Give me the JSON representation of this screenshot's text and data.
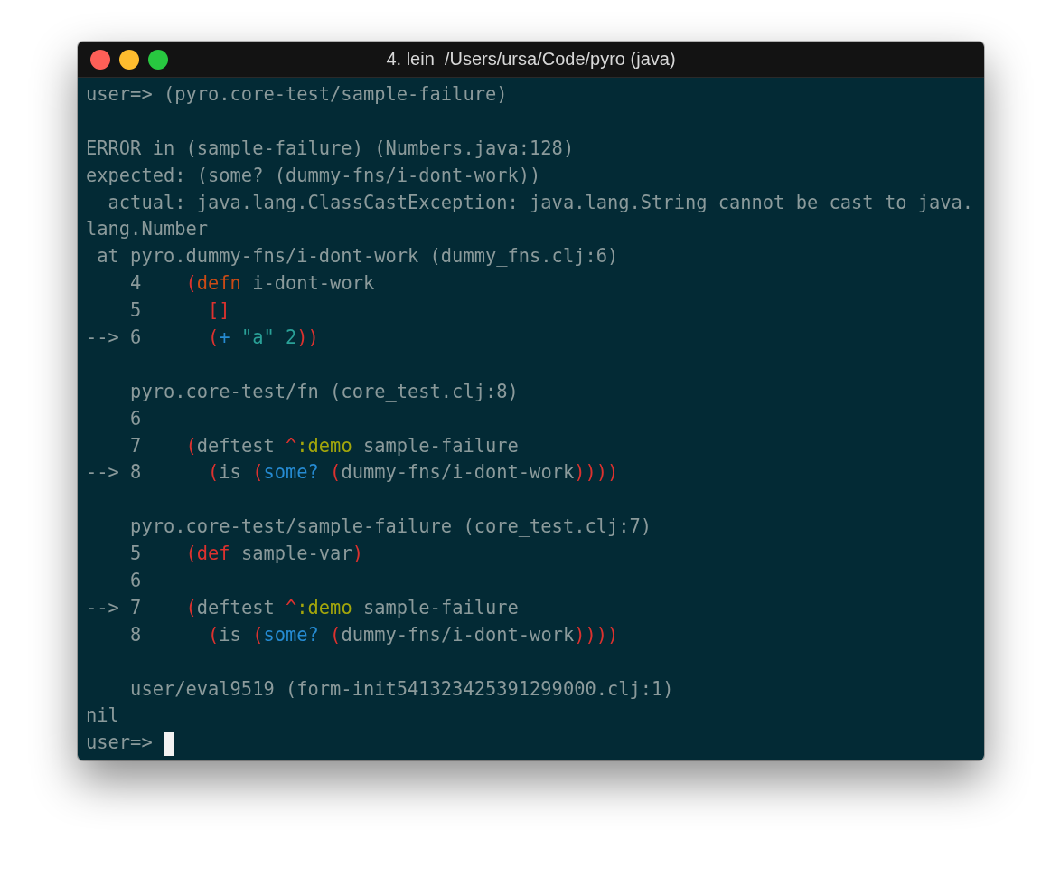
{
  "window": {
    "title": "4. lein  /Users/ursa/Code/pyro (java)"
  },
  "terminal": {
    "lines": [
      {
        "kind": "text",
        "segments": [
          {
            "text": "user=> (pyro.core-test/sample-failure)",
            "kind": "plain"
          }
        ]
      },
      {
        "kind": "blank"
      },
      {
        "kind": "text",
        "segments": [
          {
            "text": "ERROR in (sample-failure) (Numbers.java:128)",
            "kind": "plain"
          }
        ]
      },
      {
        "kind": "text",
        "segments": [
          {
            "text": "expected: (some? (dummy-fns/i-dont-work))",
            "kind": "plain"
          }
        ]
      },
      {
        "kind": "text",
        "segments": [
          {
            "text": "  actual: java.lang.ClassCastException: java.lang.String cannot be cast to java.",
            "kind": "plain"
          }
        ]
      },
      {
        "kind": "text",
        "segments": [
          {
            "text": "lang.Number",
            "kind": "plain"
          }
        ]
      },
      {
        "kind": "text",
        "segments": [
          {
            "text": " at pyro.dummy-fns/i-dont-work (dummy_fns.clj:6)",
            "kind": "plain"
          }
        ]
      },
      {
        "kind": "text",
        "segments": [
          {
            "text": "    4    ",
            "kind": "plain"
          },
          {
            "text": "(",
            "kind": "paren"
          },
          {
            "text": "defn",
            "kind": "macro"
          },
          {
            "text": " i-dont-work",
            "kind": "plain"
          }
        ]
      },
      {
        "kind": "text",
        "segments": [
          {
            "text": "    5      ",
            "kind": "plain"
          },
          {
            "text": "[]",
            "kind": "paren"
          }
        ]
      },
      {
        "kind": "text",
        "segments": [
          {
            "text": "--> 6      ",
            "kind": "plain"
          },
          {
            "text": "(",
            "kind": "paren"
          },
          {
            "text": "+",
            "kind": "function"
          },
          {
            "text": " \"a\"",
            "kind": "literal"
          },
          {
            "text": " 2",
            "kind": "literal"
          },
          {
            "text": "))",
            "kind": "paren"
          }
        ]
      },
      {
        "kind": "blank"
      },
      {
        "kind": "text",
        "segments": [
          {
            "text": "    pyro.core-test/fn (core_test.clj:8)",
            "kind": "plain"
          }
        ]
      },
      {
        "kind": "text",
        "segments": [
          {
            "text": "    6",
            "kind": "plain"
          }
        ]
      },
      {
        "kind": "text",
        "segments": [
          {
            "text": "    7    ",
            "kind": "plain"
          },
          {
            "text": "(",
            "kind": "paren"
          },
          {
            "text": "deftest ",
            "kind": "plain"
          },
          {
            "text": "^",
            "kind": "paren"
          },
          {
            "text": ":demo",
            "kind": "keyword"
          },
          {
            "text": " sample-failure",
            "kind": "plain"
          }
        ]
      },
      {
        "kind": "text",
        "segments": [
          {
            "text": "--> 8      ",
            "kind": "plain"
          },
          {
            "text": "(",
            "kind": "paren"
          },
          {
            "text": "is ",
            "kind": "plain"
          },
          {
            "text": "(",
            "kind": "paren"
          },
          {
            "text": "some?",
            "kind": "function"
          },
          {
            "text": " (",
            "kind": "paren"
          },
          {
            "text": "dummy-fns/i-dont-work",
            "kind": "plain"
          },
          {
            "text": "))))",
            "kind": "paren"
          }
        ]
      },
      {
        "kind": "blank"
      },
      {
        "kind": "text",
        "segments": [
          {
            "text": "    pyro.core-test/sample-failure (core_test.clj:7)",
            "kind": "plain"
          }
        ]
      },
      {
        "kind": "text",
        "segments": [
          {
            "text": "    5    ",
            "kind": "plain"
          },
          {
            "text": "(",
            "kind": "paren"
          },
          {
            "text": "def",
            "kind": "special"
          },
          {
            "text": " sample-var",
            "kind": "plain"
          },
          {
            "text": ")",
            "kind": "paren"
          }
        ]
      },
      {
        "kind": "text",
        "segments": [
          {
            "text": "    6",
            "kind": "plain"
          }
        ]
      },
      {
        "kind": "text",
        "segments": [
          {
            "text": "--> 7    ",
            "kind": "plain"
          },
          {
            "text": "(",
            "kind": "paren"
          },
          {
            "text": "deftest ",
            "kind": "plain"
          },
          {
            "text": "^",
            "kind": "paren"
          },
          {
            "text": ":demo",
            "kind": "keyword"
          },
          {
            "text": " sample-failure",
            "kind": "plain"
          }
        ]
      },
      {
        "kind": "text",
        "segments": [
          {
            "text": "    8      ",
            "kind": "plain"
          },
          {
            "text": "(",
            "kind": "paren"
          },
          {
            "text": "is ",
            "kind": "plain"
          },
          {
            "text": "(",
            "kind": "paren"
          },
          {
            "text": "some?",
            "kind": "function"
          },
          {
            "text": " (",
            "kind": "paren"
          },
          {
            "text": "dummy-fns/i-dont-work",
            "kind": "plain"
          },
          {
            "text": "))))",
            "kind": "paren"
          }
        ]
      },
      {
        "kind": "blank"
      },
      {
        "kind": "text",
        "segments": [
          {
            "text": "    user/eval9519 (form-init541323425391299000.clj:1)",
            "kind": "plain"
          }
        ]
      },
      {
        "kind": "text",
        "segments": [
          {
            "text": "nil",
            "kind": "plain"
          }
        ]
      },
      {
        "kind": "prompt",
        "segments": [
          {
            "text": "user=> ",
            "kind": "plain"
          }
        ]
      }
    ]
  }
}
